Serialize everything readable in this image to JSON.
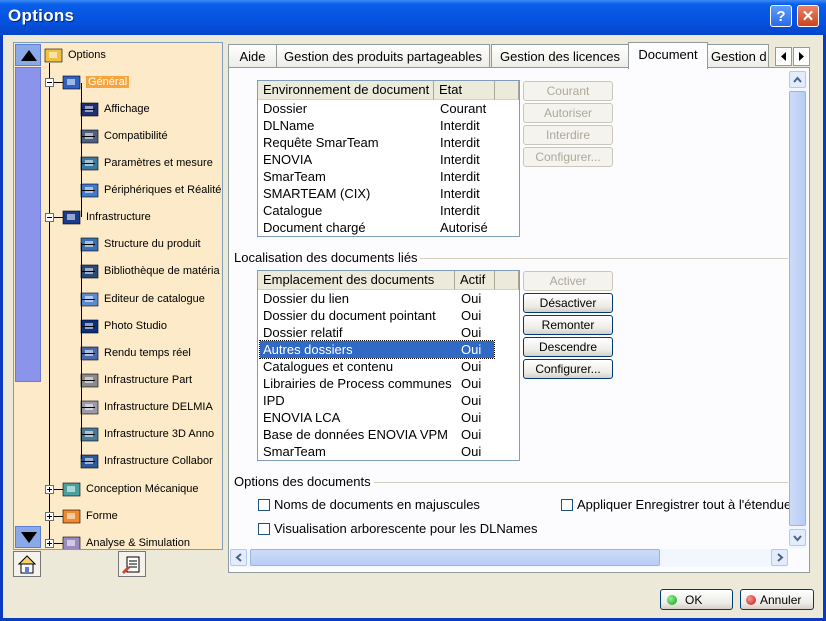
{
  "window": {
    "title": "Options",
    "help_label": "?",
    "close_label": "✕"
  },
  "tree": {
    "items": [
      {
        "label": "Options",
        "icon": "options-icon"
      },
      {
        "label": "Général",
        "icon": "general-icon",
        "selected": true
      },
      {
        "label": "Affichage",
        "icon": "display-icon"
      },
      {
        "label": "Compatibilité",
        "icon": "compatibility-icon"
      },
      {
        "label": "Paramètres et mesure",
        "icon": "parameters-icon"
      },
      {
        "label": "Périphériques et Réalité",
        "icon": "devices-icon"
      },
      {
        "label": "Infrastructure",
        "icon": "infrastructure-icon"
      },
      {
        "label": "Structure du produit",
        "icon": "product-structure-icon"
      },
      {
        "label": "Bibliothèque de matéria",
        "icon": "material-library-icon"
      },
      {
        "label": "Editeur de catalogue",
        "icon": "catalog-editor-icon"
      },
      {
        "label": "Photo Studio",
        "icon": "photo-studio-icon"
      },
      {
        "label": "Rendu temps réel",
        "icon": "realtime-render-icon"
      },
      {
        "label": "Infrastructure Part",
        "icon": "part-infrastructure-icon"
      },
      {
        "label": "Infrastructure DELMIA",
        "icon": "delmia-icon"
      },
      {
        "label": "Infrastructure 3D Anno",
        "icon": "3d-annotation-icon"
      },
      {
        "label": "Infrastructure Collabor",
        "icon": "collaboration-icon"
      },
      {
        "label": "Conception Mécanique",
        "icon": "mechanical-design-icon"
      },
      {
        "label": "Forme",
        "icon": "shape-icon"
      },
      {
        "label": "Analyse & Simulation",
        "icon": "analysis-icon"
      }
    ]
  },
  "tabs": [
    {
      "label": "Aide"
    },
    {
      "label": "Gestion des produits partageables"
    },
    {
      "label": "Gestion des licences"
    },
    {
      "label": "Document",
      "active": true
    },
    {
      "label": "Gestion d"
    }
  ],
  "env_table": {
    "headers": [
      "Environnement de document",
      "Etat"
    ],
    "rows": [
      [
        "Dossier",
        "Courant"
      ],
      [
        "DLName",
        "Interdit"
      ],
      [
        "Requête SmarTeam",
        "Interdit"
      ],
      [
        "ENOVIA",
        "Interdit"
      ],
      [
        "SmarTeam",
        "Interdit"
      ],
      [
        "SMARTEAM (CIX)",
        "Interdit"
      ],
      [
        "Catalogue",
        "Interdit"
      ],
      [
        "Document chargé",
        "Autorisé"
      ]
    ],
    "buttons": [
      "Courant",
      "Autoriser",
      "Interdire",
      "Configurer..."
    ]
  },
  "linked": {
    "group_label": "Localisation des documents liés",
    "headers": [
      "Emplacement des documents",
      "Actif"
    ],
    "rows": [
      [
        "Dossier du lien",
        "Oui"
      ],
      [
        "Dossier du document pointant",
        "Oui"
      ],
      [
        "Dossier relatif",
        "Oui"
      ],
      [
        "Autres dossiers",
        "Oui"
      ],
      [
        "Catalogues et contenu",
        "Oui"
      ],
      [
        "Librairies de Process communes",
        "Oui"
      ],
      [
        "IPD",
        "Oui"
      ],
      [
        "ENOVIA LCA",
        "Oui"
      ],
      [
        "Base de données ENOVIA VPM",
        "Oui"
      ],
      [
        "SmarTeam",
        "Oui"
      ]
    ],
    "selected_row": 3,
    "buttons": [
      "Activer",
      "Désactiver",
      "Remonter",
      "Descendre",
      "Configurer..."
    ]
  },
  "doc_options": {
    "group_label": "Options des documents",
    "uppercase_label": "Noms de documents en majuscules",
    "apply_save_label": "Appliquer Enregistrer tout à l'étendue",
    "tree_view_label": "Visualisation arborescente pour les DLNames"
  },
  "footer": {
    "ok_label": "OK",
    "cancel_label": "Annuler"
  }
}
